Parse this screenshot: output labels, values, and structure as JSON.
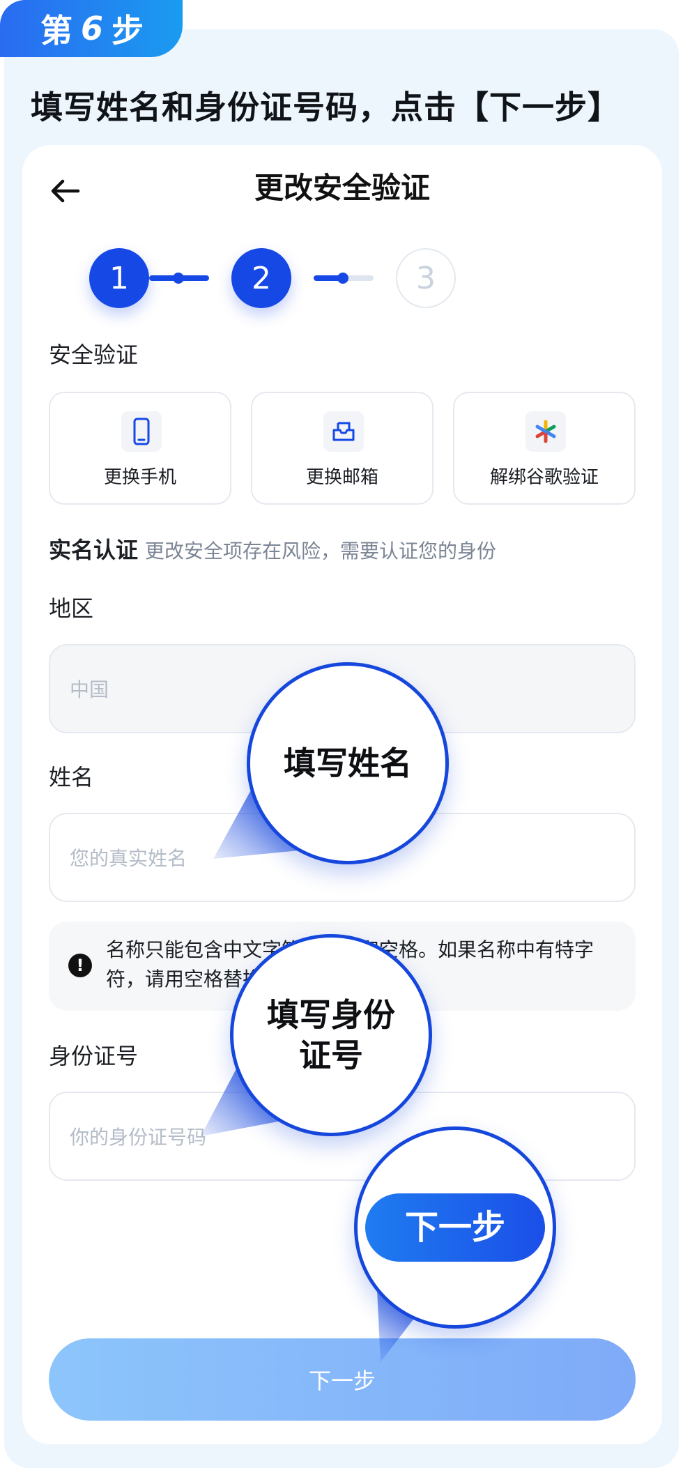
{
  "step_badge": {
    "prefix": "第",
    "number": "6",
    "suffix": "步"
  },
  "headline": "填写姓名和身份证号码，点击【下一步】",
  "header": {
    "title": "更改安全验证"
  },
  "stepper": {
    "steps": [
      "1",
      "2",
      "3"
    ]
  },
  "security": {
    "label": "安全验证",
    "options": [
      {
        "label": "更换手机",
        "icon": "phone-icon"
      },
      {
        "label": "更换邮箱",
        "icon": "mailbox-icon"
      },
      {
        "label": "解绑谷歌验证",
        "icon": "google-authenticator-icon"
      }
    ]
  },
  "realname": {
    "label": "实名认证",
    "description": "更改安全项存在风险，需要认证您的身份"
  },
  "region": {
    "label": "地区",
    "value": "中国"
  },
  "name": {
    "label": "姓名",
    "placeholder": "您的真实姓名"
  },
  "notice": {
    "text": "名称只能包含中文字符、字母和空格。如果名称中有特字符，请用空格替换。"
  },
  "id_number": {
    "label": "身份证号",
    "placeholder": "你的身份证号码"
  },
  "submit": {
    "label": "下一步"
  },
  "callouts": {
    "name": "填写姓名",
    "id_line1": "填写身份",
    "id_line2": "证号",
    "next": "下一步"
  },
  "colors": {
    "primary": "#1648e6",
    "badge": "#2a6bf1",
    "background": "#eef6fd"
  }
}
